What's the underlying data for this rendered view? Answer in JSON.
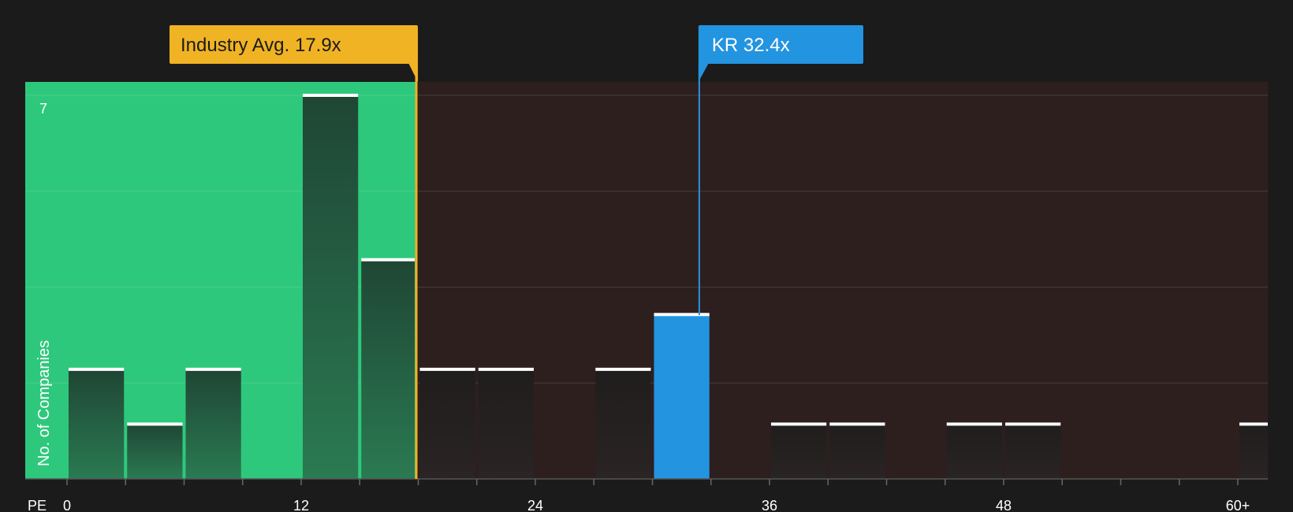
{
  "chart_data": {
    "type": "bar",
    "xlabel": "PE",
    "ylabel": "No. of Companies",
    "x_ticks": [
      "0",
      "12",
      "24",
      "36",
      "48",
      "60+"
    ],
    "x_tick_values": [
      0,
      12,
      24,
      36,
      48,
      60
    ],
    "y_max_label": "7",
    "ylim": [
      0,
      7
    ],
    "bin_width": 3,
    "bins": [
      {
        "x0": 0,
        "x1": 3,
        "count": 2
      },
      {
        "x0": 3,
        "x1": 6,
        "count": 1
      },
      {
        "x0": 6,
        "x1": 9,
        "count": 2
      },
      {
        "x0": 9,
        "x1": 12,
        "count": 0
      },
      {
        "x0": 12,
        "x1": 15,
        "count": 7
      },
      {
        "x0": 15,
        "x1": 18,
        "count": 4
      },
      {
        "x0": 18,
        "x1": 21,
        "count": 2
      },
      {
        "x0": 21,
        "x1": 24,
        "count": 2
      },
      {
        "x0": 24,
        "x1": 27,
        "count": 0
      },
      {
        "x0": 27,
        "x1": 30,
        "count": 2
      },
      {
        "x0": 30,
        "x1": 33,
        "count": 3,
        "highlight": true
      },
      {
        "x0": 33,
        "x1": 36,
        "count": 0
      },
      {
        "x0": 36,
        "x1": 39,
        "count": 1
      },
      {
        "x0": 39,
        "x1": 42,
        "count": 1
      },
      {
        "x0": 42,
        "x1": 45,
        "count": 0
      },
      {
        "x0": 45,
        "x1": 48,
        "count": 1
      },
      {
        "x0": 48,
        "x1": 51,
        "count": 1
      },
      {
        "x0": 51,
        "x1": 54,
        "count": 0
      },
      {
        "x0": 54,
        "x1": 57,
        "count": 0
      },
      {
        "x0": 57,
        "x1": 60,
        "count": 0
      },
      {
        "x0": 60,
        "x1": 63,
        "count": 1
      }
    ],
    "markers": [
      {
        "name": "industry-avg",
        "label": "Industry Avg. 17.9x",
        "value": 17.9,
        "color": "#f0b323"
      },
      {
        "name": "kr",
        "label": "KR 32.4x",
        "value": 32.4,
        "color": "#2394e0"
      }
    ],
    "grid": true
  },
  "colors": {
    "background": "#1b1b1b",
    "below_avg_region": "#2ec87c",
    "above_avg_region": "#2e1f1f",
    "bar_in_green": "#225b40",
    "bar_in_red": "#231e1e",
    "highlight_bar": "#2394e0",
    "gridline": "#4a3c3c",
    "bar_cap": "#ffffff"
  }
}
